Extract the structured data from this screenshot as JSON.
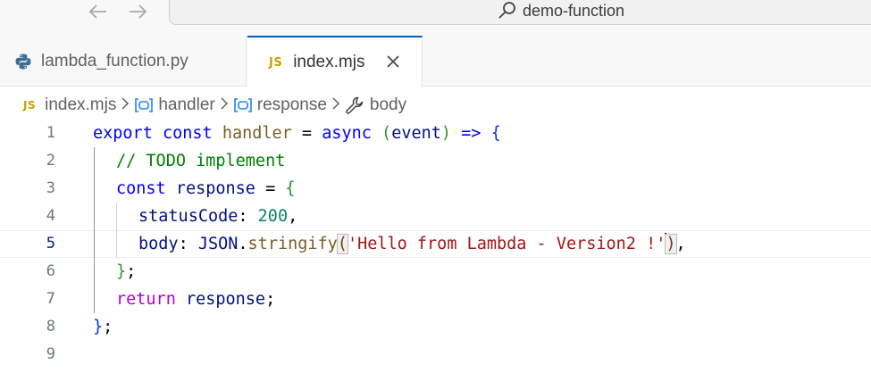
{
  "titlebar": {
    "back_icon": "arrow-left-icon",
    "forward_icon": "arrow-right-icon",
    "search_icon": "search-icon",
    "search_text": "demo-function"
  },
  "tabs": [
    {
      "label": "lambda_function.py",
      "icon": "python-icon",
      "active": false
    },
    {
      "label": "index.mjs",
      "icon": "js-icon",
      "icon_text": "JS",
      "active": true,
      "close_icon": "close-icon"
    }
  ],
  "breadcrumb": {
    "file_icon_text": "JS",
    "items": [
      "index.mjs",
      "handler",
      "response",
      "body"
    ]
  },
  "editor": {
    "current_line": 5,
    "line_numbers": [
      "1",
      "2",
      "3",
      "4",
      "5",
      "6",
      "7",
      "8",
      "9"
    ],
    "tokens": {
      "l1": [
        "export",
        " ",
        "const",
        " ",
        "handler",
        " = ",
        "async",
        " ",
        "(",
        "event",
        ")",
        " => ",
        "{"
      ],
      "l2": [
        "// TODO implement"
      ],
      "l3": [
        "const",
        " ",
        "response",
        " = ",
        "{"
      ],
      "l4": [
        "statusCode",
        ": ",
        "200",
        ","
      ],
      "l5": [
        "body",
        ": ",
        "JSON",
        ".",
        "stringify",
        "(",
        "'Hello from Lambda - Version2 !'",
        ")",
        ","
      ],
      "l6": [
        "}",
        ";"
      ],
      "l7": [
        "return",
        " ",
        "response",
        ";"
      ],
      "l8": [
        "}",
        ";"
      ]
    }
  },
  "colors": {
    "keyword": "#0000ff",
    "control_keyword": "#af00db",
    "variable": "#001080",
    "function": "#795e26",
    "class": "#267f99",
    "string": "#a31515",
    "number": "#098658",
    "comment": "#008000",
    "accent": "#005fb8"
  }
}
